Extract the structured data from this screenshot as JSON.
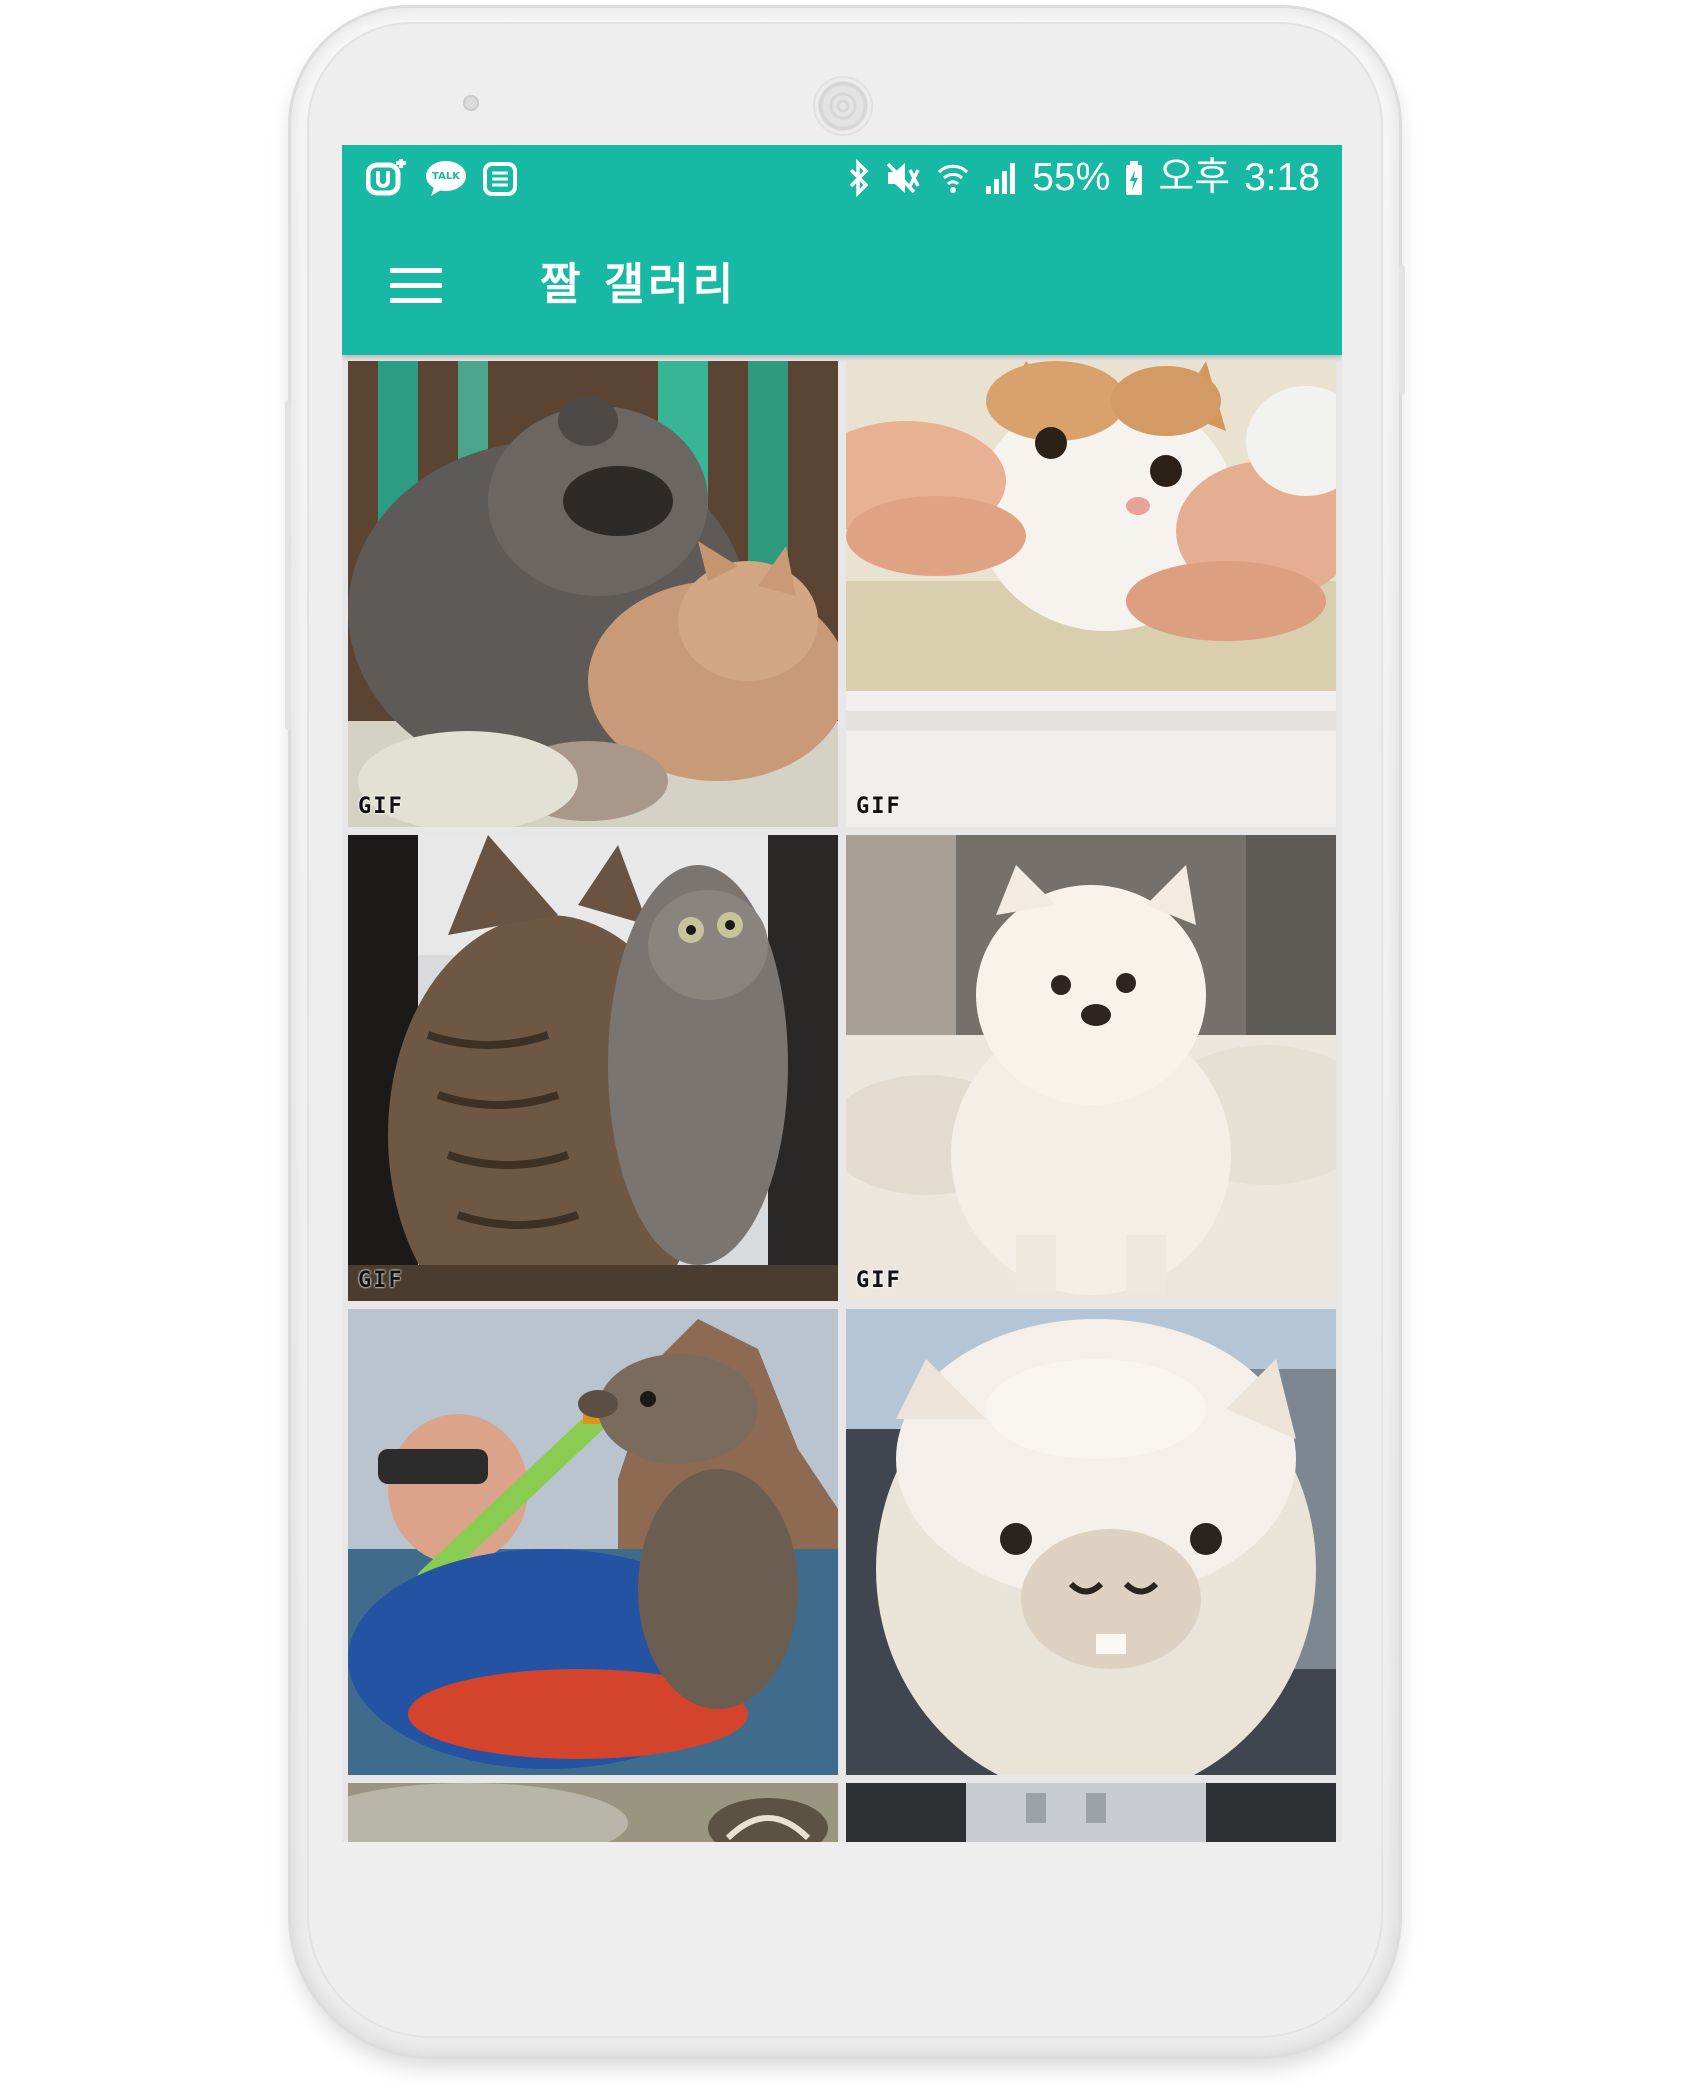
{
  "status_bar": {
    "left_icons": [
      "u-plus-icon",
      "kakaotalk-icon",
      "notification-list-icon"
    ],
    "talk_badge": "TALK",
    "battery": "55%",
    "time_period": "오후",
    "time": "3:18",
    "right_icons": [
      "bluetooth-icon",
      "vibrate-mute-icon",
      "wifi-icon",
      "signal-icon",
      "battery-charging-icon"
    ]
  },
  "app_bar": {
    "title": "짤 갤러리",
    "menu_icon": "hamburger-menu-icon",
    "color": "#17b9a4"
  },
  "gallery": {
    "items": [
      {
        "subject": "raccoon hugging cat",
        "badge": "GIF"
      },
      {
        "subject": "hands squeezing white cat's cheeks",
        "badge": "GIF"
      },
      {
        "subject": "two tabby cats at glass door",
        "badge": "GIF"
      },
      {
        "subject": "white pomeranian on bed",
        "badge": "GIF"
      },
      {
        "subject": "snorkeler and sea lion",
        "badge": ""
      },
      {
        "subject": "fluffy white alpaca",
        "badge": ""
      },
      {
        "subject": "partially visible image",
        "badge": ""
      },
      {
        "subject": "partially visible image",
        "badge": ""
      }
    ]
  }
}
